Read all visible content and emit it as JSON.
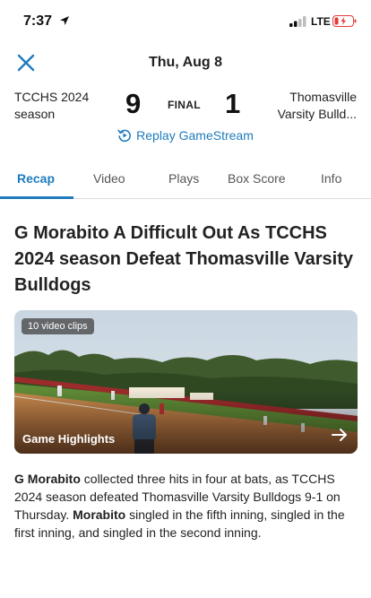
{
  "status_bar": {
    "time": "7:37",
    "carrier": "LTE",
    "icons": [
      "location-arrow-icon",
      "signal-bars-icon",
      "battery-low-icon"
    ]
  },
  "header": {
    "date": "Thu, Aug 8",
    "close_icon": "close-icon"
  },
  "scoreboard": {
    "home_team": "TCCHS 2024 season",
    "home_score": "9",
    "status": "FINAL",
    "away_score": "1",
    "away_team": "Thomasville Varsity Bulld...",
    "replay_label": "Replay GameStream",
    "replay_icon": "replay-icon"
  },
  "tabs": [
    {
      "label": "Recap",
      "active": true
    },
    {
      "label": "Video",
      "active": false
    },
    {
      "label": "Plays",
      "active": false
    },
    {
      "label": "Box Score",
      "active": false
    },
    {
      "label": "Info",
      "active": false
    }
  ],
  "article": {
    "headline": "G Morabito A Difficult Out As TCCHS 2024 season Defeat Thomasville Varsity Bulldogs",
    "video": {
      "badge": "10 video clips",
      "title": "Game Highlights",
      "arrow_icon": "arrow-right-icon"
    },
    "body": {
      "name_1": "G Morabito",
      "text_1": " collected three hits in four at bats, as TCCHS 2024 season defeated Thomasville Varsity Bulldogs 9-1 on Thursday. ",
      "name_2": "Morabito",
      "text_2": " singled in the fifth inning, singled in the first inning, and singled in the second inning."
    }
  },
  "colors": {
    "accent": "#1f7bbd",
    "text": "#222222",
    "divider": "#dcdcdc"
  }
}
